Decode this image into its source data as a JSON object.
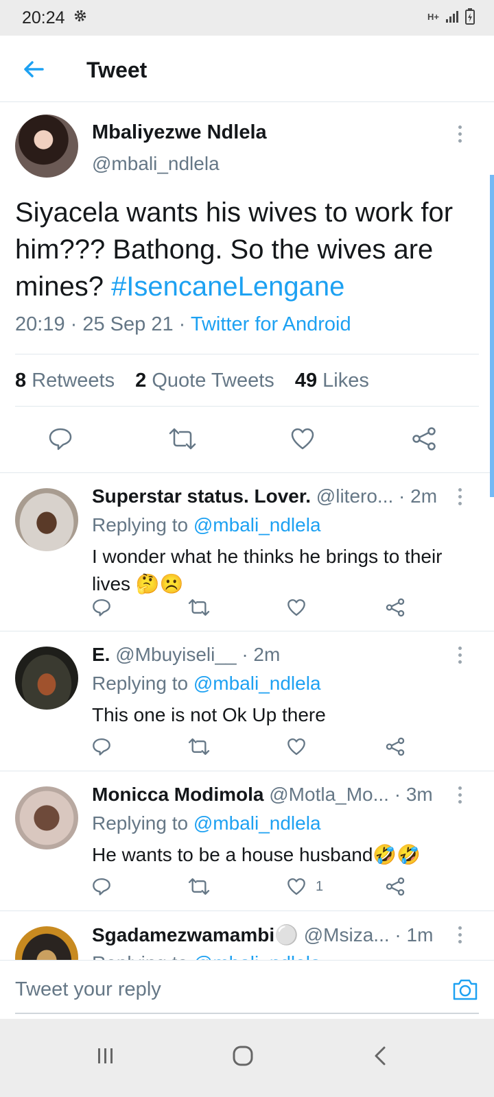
{
  "status_bar": {
    "time": "20:24",
    "network": "H+"
  },
  "header": {
    "title": "Tweet"
  },
  "main_tweet": {
    "name": "Mbaliyezwe Ndlela",
    "handle": "@mbali_ndlela",
    "text": "Siyacela wants his wives to work for him??? Bathong. So the wives are mines? ",
    "hashtag": "#IsencaneLengane",
    "time": "20:19",
    "date": "25 Sep 21",
    "source": "Twitter for Android",
    "retweets_count": "8",
    "retweets_label": "Retweets",
    "quotes_count": "2",
    "quotes_label": "Quote Tweets",
    "likes_count": "49",
    "likes_label": "Likes"
  },
  "replies": [
    {
      "name": "Superstar status. Lover.",
      "handle": "@litero...",
      "time": "· 2m",
      "replying_prefix": "Replying to ",
      "replying_to": "@mbali_ndlela",
      "text": "I wonder what he thinks he brings to their lives 🤔☹️",
      "likes": ""
    },
    {
      "name": "E.",
      "handle": "@Mbuyiseli__",
      "time": "· 2m",
      "replying_prefix": "Replying to ",
      "replying_to": "@mbali_ndlela",
      "text": "This one is not Ok Up there",
      "likes": ""
    },
    {
      "name": "Monicca Modimola",
      "handle": "@Motla_Mo...",
      "time": "· 3m",
      "replying_prefix": "Replying to ",
      "replying_to": "@mbali_ndlela",
      "text": "He wants to be a house husband🤣🤣",
      "likes": "1"
    },
    {
      "name": "Sgadamezwamambi⚪",
      "handle": "@Msiza...",
      "time": "· 1m",
      "replying_prefix": "Replying to ",
      "replying_to": "@mbali_ndlela",
      "text": "",
      "likes": ""
    }
  ],
  "composer": {
    "placeholder": "Tweet your reply"
  },
  "colors": {
    "accent": "#1da1f2",
    "secondary_text": "#657786",
    "divider": "#e1e8ed"
  }
}
